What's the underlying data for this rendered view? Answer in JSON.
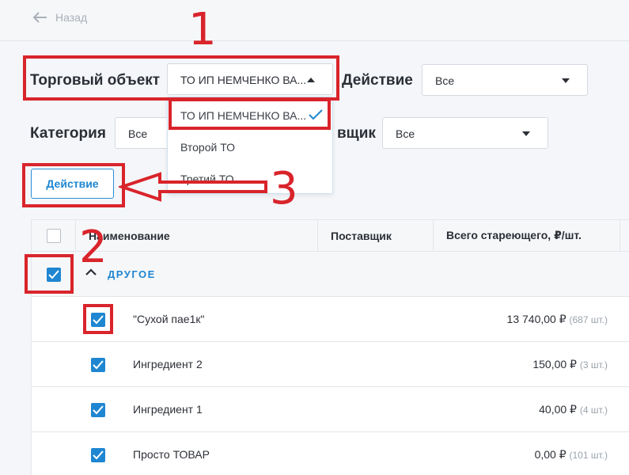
{
  "header": {
    "back_label": "Назад"
  },
  "filters": {
    "trade_object": {
      "label": "Торговый объект",
      "value": "ТО ИП НЕМЧЕНКО ВА..."
    },
    "action": {
      "label": "Действие",
      "value": "Все"
    },
    "category": {
      "label": "Категория",
      "value": "Все"
    },
    "supplier": {
      "label_visible": "вщик",
      "value": "Все"
    },
    "dropdown_options": [
      {
        "label": "ТО ИП НЕМЧЕНКО ВА...",
        "selected": true
      },
      {
        "label": "Второй ТО",
        "selected": false
      },
      {
        "label": "Третий ТО",
        "selected": false
      }
    ]
  },
  "action_button": {
    "label": "Действие"
  },
  "table": {
    "headers": [
      "Наименование",
      "Поставщик",
      "Всего стареющего, ₽/шт."
    ],
    "group": {
      "title": "ДРУГОЕ",
      "checked": true
    },
    "rows": [
      {
        "name": "\"Сухой пае1к\"",
        "amount": "13 740,00 ₽",
        "qty": "(687 шт.)",
        "checked": true
      },
      {
        "name": "Ингредиент 2",
        "amount": "150,00 ₽",
        "qty": "(3 шт.)",
        "checked": true
      },
      {
        "name": "Ингредиент 1",
        "amount": "40,00 ₽",
        "qty": "(4 шт.)",
        "checked": true
      },
      {
        "name": "Просто ТОВАР",
        "amount": "0,00 ₽",
        "qty": "(101 шт.)",
        "checked": true
      }
    ]
  },
  "annotations": {
    "one": "1",
    "two": "2",
    "three": "3"
  },
  "colors": {
    "accent": "#1f86d1",
    "annotation": "#d9242b",
    "background": "#f4f6f9"
  }
}
